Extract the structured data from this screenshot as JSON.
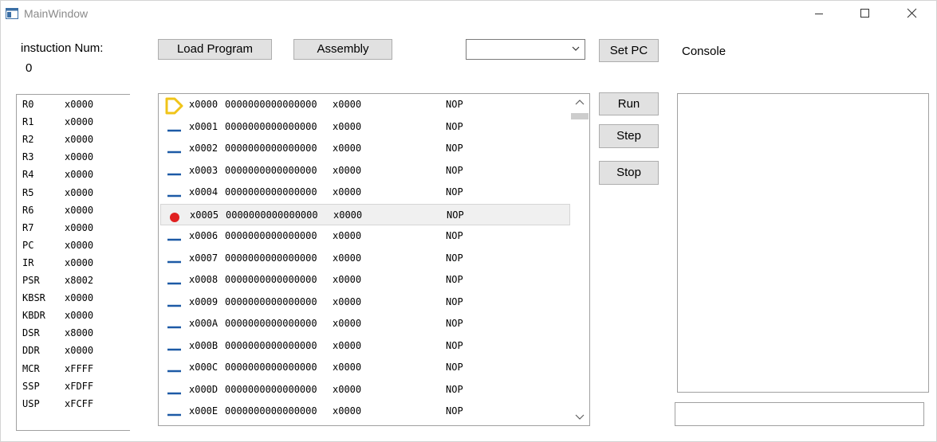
{
  "window": {
    "title": "MainWindow",
    "controls": [
      "minimize-icon",
      "maximize-icon",
      "close-icon"
    ]
  },
  "instruction": {
    "label": "instuction Num:",
    "value": "0"
  },
  "toolbar": {
    "load_label": "Load Program",
    "assembly_label": "Assembly",
    "combo_value": "",
    "set_pc_label": "Set PC",
    "console_label": "Console"
  },
  "controls": {
    "run_label": "Run",
    "step_label": "Step",
    "stop_label": "Stop"
  },
  "registers": [
    {
      "name": "R0",
      "value": "x0000"
    },
    {
      "name": "R1",
      "value": "x0000"
    },
    {
      "name": "R2",
      "value": "x0000"
    },
    {
      "name": "R3",
      "value": "x0000"
    },
    {
      "name": "R4",
      "value": "x0000"
    },
    {
      "name": "R5",
      "value": "x0000"
    },
    {
      "name": "R6",
      "value": "x0000"
    },
    {
      "name": "R7",
      "value": "x0000"
    },
    {
      "name": "PC",
      "value": "x0000"
    },
    {
      "name": "IR",
      "value": "x0000"
    },
    {
      "name": "PSR",
      "value": "x8002"
    },
    {
      "name": "KBSR",
      "value": "x0000"
    },
    {
      "name": "KBDR",
      "value": "x0000"
    },
    {
      "name": "DSR",
      "value": "x8000"
    },
    {
      "name": "DDR",
      "value": "x0000"
    },
    {
      "name": "MCR",
      "value": "xFFFF"
    },
    {
      "name": "SSP",
      "value": "xFDFF"
    },
    {
      "name": "USP",
      "value": "xFCFF"
    }
  ],
  "memory": [
    {
      "marker": "pc-arrow-icon",
      "address": "x0000",
      "bits": "0000000000000000",
      "hex": "x0000",
      "instr": "NOP"
    },
    {
      "marker": "dash-icon",
      "address": "x0001",
      "bits": "0000000000000000",
      "hex": "x0000",
      "instr": "NOP"
    },
    {
      "marker": "dash-icon",
      "address": "x0002",
      "bits": "0000000000000000",
      "hex": "x0000",
      "instr": "NOP"
    },
    {
      "marker": "dash-icon",
      "address": "x0003",
      "bits": "0000000000000000",
      "hex": "x0000",
      "instr": "NOP"
    },
    {
      "marker": "dash-icon",
      "address": "x0004",
      "bits": "0000000000000000",
      "hex": "x0000",
      "instr": "NOP"
    },
    {
      "marker": "breakpoint-icon",
      "address": "x0005",
      "bits": "0000000000000000",
      "hex": "x0000",
      "instr": "NOP",
      "selected": true
    },
    {
      "marker": "dash-icon",
      "address": "x0006",
      "bits": "0000000000000000",
      "hex": "x0000",
      "instr": "NOP"
    },
    {
      "marker": "dash-icon",
      "address": "x0007",
      "bits": "0000000000000000",
      "hex": "x0000",
      "instr": "NOP"
    },
    {
      "marker": "dash-icon",
      "address": "x0008",
      "bits": "0000000000000000",
      "hex": "x0000",
      "instr": "NOP"
    },
    {
      "marker": "dash-icon",
      "address": "x0009",
      "bits": "0000000000000000",
      "hex": "x0000",
      "instr": "NOP"
    },
    {
      "marker": "dash-icon",
      "address": "x000A",
      "bits": "0000000000000000",
      "hex": "x0000",
      "instr": "NOP"
    },
    {
      "marker": "dash-icon",
      "address": "x000B",
      "bits": "0000000000000000",
      "hex": "x0000",
      "instr": "NOP"
    },
    {
      "marker": "dash-icon",
      "address": "x000C",
      "bits": "0000000000000000",
      "hex": "x0000",
      "instr": "NOP"
    },
    {
      "marker": "dash-icon",
      "address": "x000D",
      "bits": "0000000000000000",
      "hex": "x0000",
      "instr": "NOP"
    },
    {
      "marker": "dash-icon",
      "address": "x000E",
      "bits": "0000000000000000",
      "hex": "x0000",
      "instr": "NOP"
    }
  ],
  "colors": {
    "pc_arrow": "#f0c419",
    "breakpoint": "#e02020",
    "dash": "#1d5aa6"
  },
  "console": {
    "input_value": ""
  }
}
